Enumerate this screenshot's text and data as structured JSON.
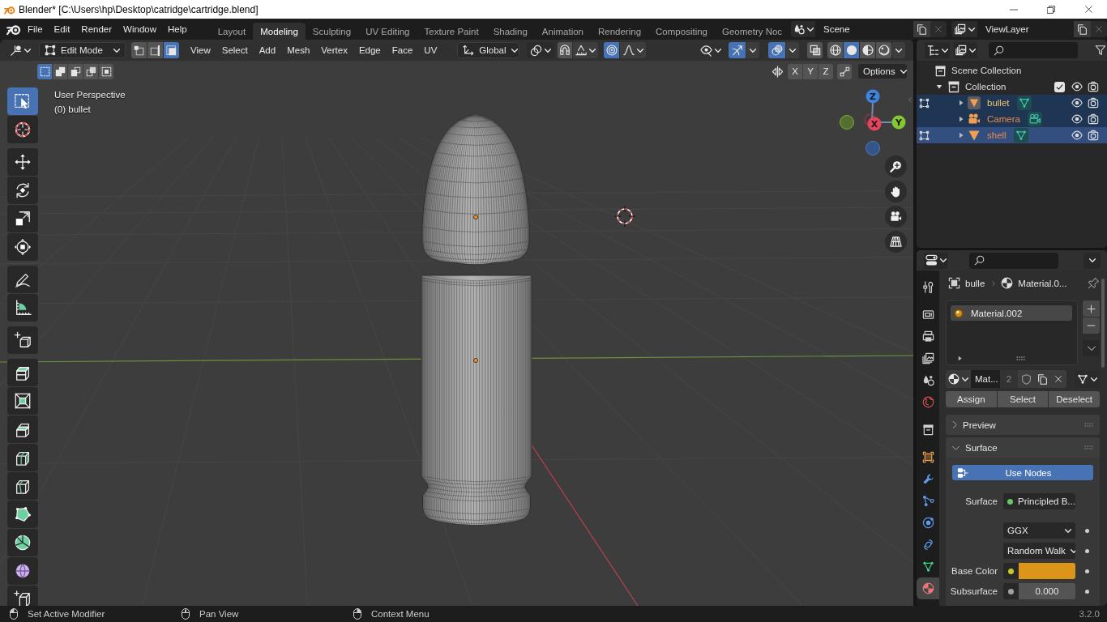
{
  "window": {
    "title": "Blender* [C:\\Users\\hp\\Desktop\\catridge\\cartridge.blend]"
  },
  "top_bar": {
    "menus": [
      "File",
      "Edit",
      "Render",
      "Window",
      "Help"
    ],
    "workspaces": [
      {
        "label": "Layout",
        "selected": false
      },
      {
        "label": "Modeling",
        "selected": true
      },
      {
        "label": "Sculpting",
        "selected": false
      },
      {
        "label": "UV Editing",
        "selected": false
      },
      {
        "label": "Texture Paint",
        "selected": false
      },
      {
        "label": "Shading",
        "selected": false
      },
      {
        "label": "Animation",
        "selected": false
      },
      {
        "label": "Rendering",
        "selected": false
      },
      {
        "label": "Compositing",
        "selected": false
      },
      {
        "label": "Geometry Noc",
        "selected": false
      }
    ],
    "scene": "Scene",
    "view_layer": "ViewLayer"
  },
  "viewport": {
    "header": {
      "mode": "Edit Mode",
      "select_modes": [
        {
          "kind": "vertex",
          "selected": false
        },
        {
          "kind": "edge",
          "selected": false
        },
        {
          "kind": "face",
          "selected": true
        }
      ],
      "menus": [
        "View",
        "Select",
        "Add",
        "Mesh",
        "Vertex",
        "Edge",
        "Face",
        "UV"
      ],
      "orientation": "Global",
      "snap": {
        "on": false
      },
      "proportional_editing": {
        "on": true
      },
      "gizmos": {
        "on": true
      },
      "overlays": {
        "on": true
      },
      "xray": {
        "on": false
      },
      "shading": [
        {
          "kind": "wireframe",
          "selected": false
        },
        {
          "kind": "solid",
          "selected": true
        },
        {
          "kind": "material",
          "selected": false
        },
        {
          "kind": "rendered",
          "selected": false
        }
      ]
    },
    "tool_settings": {
      "box_modes": [
        {
          "kind": "set",
          "selected": true
        },
        {
          "kind": "extend",
          "selected": false
        },
        {
          "kind": "subtract",
          "selected": false
        },
        {
          "kind": "invert",
          "selected": false
        },
        {
          "kind": "intersect",
          "selected": false
        }
      ],
      "mirror_axes": [
        {
          "label": "X",
          "on": false
        },
        {
          "label": "Y",
          "on": false
        },
        {
          "label": "Z",
          "on": false
        }
      ],
      "auto_merge": {
        "on": false
      },
      "options": "Options"
    },
    "tool_groups": [
      [
        {
          "kind": "select_box",
          "selected": true
        },
        {
          "kind": "cursor",
          "selected": false
        }
      ],
      [
        {
          "kind": "move",
          "selected": false
        },
        {
          "kind": "rotate",
          "selected": false
        },
        {
          "kind": "scale",
          "selected": false
        },
        {
          "kind": "transform",
          "selected": false
        }
      ],
      [
        {
          "kind": "annotate",
          "selected": false
        },
        {
          "kind": "measure",
          "selected": false
        }
      ],
      [
        {
          "kind": "add_cube",
          "selected": false
        }
      ],
      [
        {
          "kind": "extrude",
          "selected": false
        },
        {
          "kind": "inset",
          "selected": false
        },
        {
          "kind": "bevel",
          "selected": false
        },
        {
          "kind": "loop_cut",
          "selected": false
        },
        {
          "kind": "knife",
          "selected": false
        },
        {
          "kind": "poly_build",
          "selected": false
        },
        {
          "kind": "spin",
          "selected": false
        },
        {
          "kind": "smooth",
          "selected": false
        },
        {
          "kind": "shear",
          "selected": false
        }
      ]
    ],
    "view_name": "User Perspective",
    "active_object": "(0) bullet",
    "gizmo_axes": [
      "X",
      "Y",
      "Z"
    ]
  },
  "outliner": {
    "root": "Scene Collection",
    "collections": [
      {
        "name": "Collection",
        "expanded": true,
        "checked": true,
        "children": [
          {
            "name": "bullet",
            "kind": "mesh",
            "expanded": false,
            "edit_mode": true,
            "active": true,
            "selected": true,
            "highlighted": false
          },
          {
            "name": "Camera",
            "kind": "camera",
            "expanded": false,
            "edit_mode": false,
            "active": false,
            "selected": true,
            "highlighted": false
          },
          {
            "name": "shell",
            "kind": "mesh",
            "expanded": false,
            "edit_mode": true,
            "active": false,
            "selected": true,
            "highlighted": true
          }
        ]
      }
    ]
  },
  "properties": {
    "tab_groups": [
      [
        {
          "kind": "tool",
          "selected": false
        }
      ],
      [
        {
          "kind": "render",
          "selected": false
        },
        {
          "kind": "output",
          "selected": false
        },
        {
          "kind": "view_layer",
          "selected": false
        },
        {
          "kind": "scene",
          "selected": false
        },
        {
          "kind": "world",
          "selected": false
        }
      ],
      [
        {
          "kind": "collection",
          "selected": false
        }
      ],
      [
        {
          "kind": "object",
          "selected": false
        },
        {
          "kind": "modifiers",
          "selected": false
        },
        {
          "kind": "particles",
          "selected": false
        },
        {
          "kind": "physics",
          "selected": false
        },
        {
          "kind": "constraints",
          "selected": false
        },
        {
          "kind": "data",
          "selected": false
        },
        {
          "kind": "material",
          "selected": true
        }
      ]
    ],
    "breadcrumb": [
      {
        "kind": "object",
        "label": "bulle"
      },
      {
        "kind": "material",
        "label": "Material.0..."
      }
    ],
    "material_slots": [
      {
        "name": "Material.002",
        "selected": true
      }
    ],
    "material_name": "Mat...",
    "users": "2",
    "slot_actions": [
      "Assign",
      "Select",
      "Deselect"
    ],
    "panels": [
      {
        "title": "Preview",
        "expanded": false
      },
      {
        "title": "Surface",
        "expanded": true,
        "use_nodes": {
          "label": "Use Nodes",
          "on": true
        },
        "rows": [
          {
            "kind": "shader",
            "label": "Surface",
            "value": "Principled B..."
          },
          {
            "kind": "enum",
            "value": "GGX"
          },
          {
            "kind": "enum",
            "value": "Random Walk"
          },
          {
            "kind": "color",
            "label": "Base Color",
            "color": "#db9519"
          },
          {
            "kind": "float",
            "label": "Subsurface",
            "value": "0.000"
          }
        ]
      }
    ]
  },
  "status_bar": {
    "hints": [
      {
        "kind": "left_click",
        "label": "Set Active Modifier"
      },
      {
        "kind": "middle_click",
        "label": "Pan View"
      },
      {
        "kind": "right_click",
        "label": "Context Menu"
      }
    ],
    "version": "3.2.0"
  }
}
